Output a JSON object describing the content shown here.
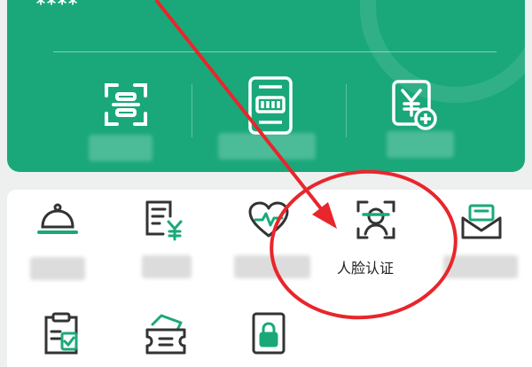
{
  "header": {
    "masked_name": "****"
  },
  "quick_actions": [
    {
      "icon": "scan-icon"
    },
    {
      "icon": "receipt-barcode-icon"
    },
    {
      "icon": "yuan-card-add-icon"
    }
  ],
  "services": [
    {
      "icon": "service-bell-icon"
    },
    {
      "icon": "invoice-yuan-icon"
    },
    {
      "icon": "heartbeat-icon"
    },
    {
      "icon": "face-recognition-icon",
      "label": "人脸认证"
    },
    {
      "icon": "mail-icon"
    },
    {
      "icon": "clipboard-check-icon"
    },
    {
      "icon": "ticket-cash-icon"
    },
    {
      "icon": "lock-device-icon"
    }
  ],
  "colors": {
    "brand_green": "#1aa87a",
    "annotation_red": "#e8262c"
  }
}
